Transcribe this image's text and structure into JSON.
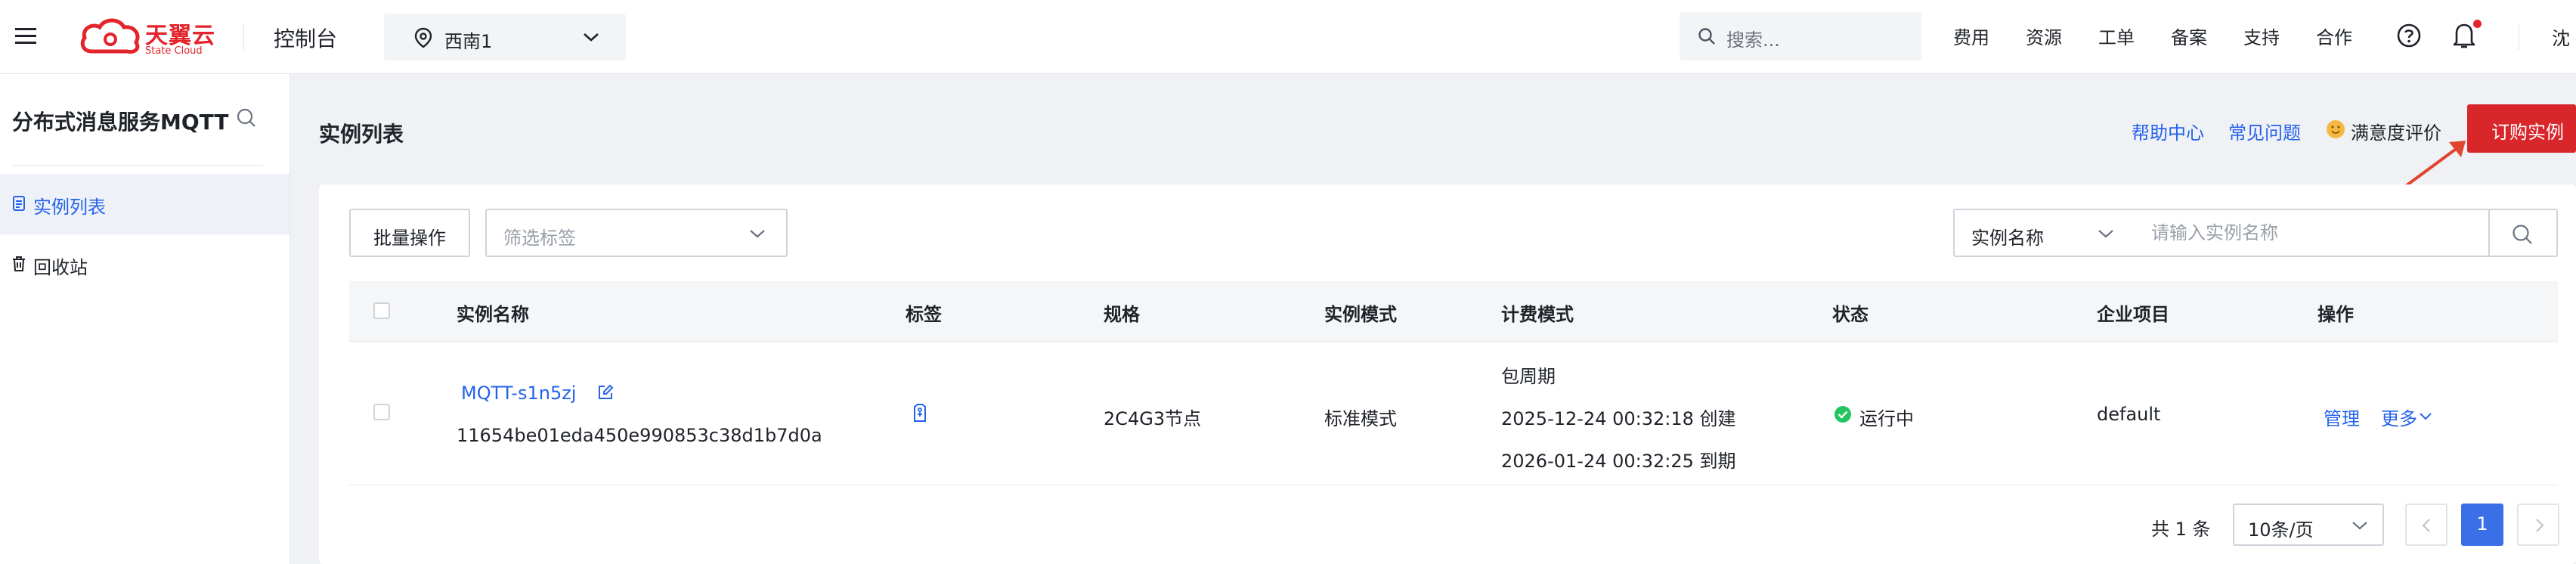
{
  "header": {
    "logo_cn": "天翼云",
    "logo_en": "State Cloud",
    "console": "控制台",
    "region": "西南1",
    "search_placeholder": "搜索...",
    "nav": [
      "费用",
      "资源",
      "工单",
      "备案",
      "支持",
      "合作"
    ],
    "user": "沈"
  },
  "sidebar": {
    "title": "分布式消息服务MQTT",
    "items": [
      {
        "label": "实例列表",
        "icon": "list-icon",
        "active": true
      },
      {
        "label": "回收站",
        "icon": "trash-icon",
        "active": false
      }
    ]
  },
  "main": {
    "title": "实例列表",
    "help_center": "帮助中心",
    "faq": "常见问题",
    "satisfaction": "满意度评价",
    "buy_button": "订购实例"
  },
  "toolbar": {
    "batch_button": "批量操作",
    "tag_filter_placeholder": "筛选标签",
    "search_type": "实例名称",
    "search_placeholder": "请输入实例名称"
  },
  "table": {
    "columns": [
      "实例名称",
      "标签",
      "规格",
      "实例模式",
      "计费模式",
      "状态",
      "企业项目",
      "操作"
    ],
    "rows": [
      {
        "name": "MQTT-s1n5zj",
        "id": "11654be01eda450e990853c38d1b7d0a",
        "spec": "2C4G3节点",
        "mode": "标准模式",
        "billing_type": "包周期",
        "created": "2025-12-24 00:32:18 创建",
        "expires": "2026-01-24 00:32:25 到期",
        "status": "运行中",
        "project": "default",
        "action_manage": "管理",
        "action_more": "更多"
      }
    ]
  },
  "pagination": {
    "total": "共 1 条",
    "page_size": "10条/页",
    "current_page": "1"
  },
  "colors": {
    "brand_red": "#e3242b",
    "link_blue": "#2563eb",
    "status_green": "#22c55e"
  }
}
